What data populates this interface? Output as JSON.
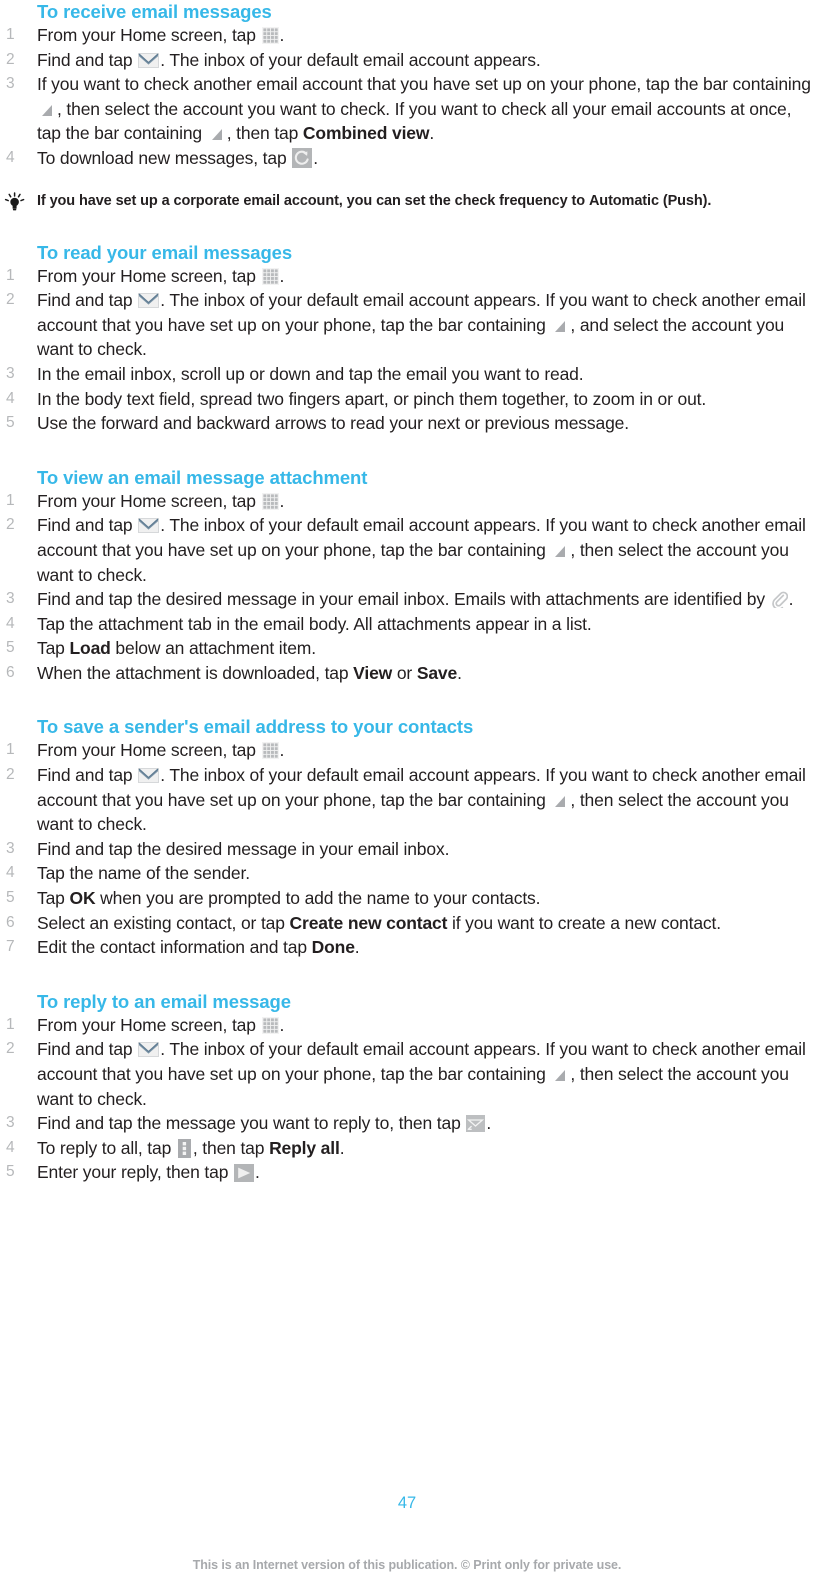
{
  "document": {
    "page_number": "47",
    "footer_note": "This is an Internet version of this publication. © Print only for private use.",
    "heading_color": "#37b8e8",
    "body_color": "#231f20",
    "number_color": "#b6b8ba",
    "footer_color": "#a7a9ac"
  },
  "sections": [
    {
      "title": "To receive email messages",
      "steps": [
        {
          "num": "1",
          "parts": [
            {
              "t": "text",
              "v": "From your Home screen, tap "
            },
            {
              "t": "icon",
              "v": "app-grid-icon"
            },
            {
              "t": "text",
              "v": "."
            }
          ]
        },
        {
          "num": "2",
          "parts": [
            {
              "t": "text",
              "v": "Find and tap "
            },
            {
              "t": "icon",
              "v": "envelope-icon"
            },
            {
              "t": "text",
              "v": ". The inbox of your default email account appears."
            }
          ]
        },
        {
          "num": "3",
          "parts": [
            {
              "t": "text",
              "v": "If you want to check another email account that you have set up on your phone, tap the bar containing "
            },
            {
              "t": "icon",
              "v": "triangle-icon"
            },
            {
              "t": "text",
              "v": ", then select the account you want to check. If you want to check all your email accounts at once, tap the bar containing "
            },
            {
              "t": "icon",
              "v": "triangle-icon"
            },
            {
              "t": "text",
              "v": ", then tap "
            },
            {
              "t": "bold",
              "v": "Combined view"
            },
            {
              "t": "text",
              "v": "."
            }
          ]
        },
        {
          "num": "4",
          "parts": [
            {
              "t": "text",
              "v": "To download new messages, tap "
            },
            {
              "t": "icon",
              "v": "refresh-icon"
            },
            {
              "t": "text",
              "v": "."
            }
          ]
        }
      ]
    },
    {
      "title": "To read your email messages",
      "steps": [
        {
          "num": "1",
          "parts": [
            {
              "t": "text",
              "v": "From your Home screen, tap "
            },
            {
              "t": "icon",
              "v": "app-grid-icon"
            },
            {
              "t": "text",
              "v": "."
            }
          ]
        },
        {
          "num": "2",
          "parts": [
            {
              "t": "text",
              "v": "Find and tap "
            },
            {
              "t": "icon",
              "v": "envelope-icon"
            },
            {
              "t": "text",
              "v": ". The inbox of your default email account appears. If you want to check another email account that you have set up on your phone, tap the bar containing "
            },
            {
              "t": "icon",
              "v": "triangle-icon"
            },
            {
              "t": "text",
              "v": ", and select the account you want to check."
            }
          ]
        },
        {
          "num": "3",
          "parts": [
            {
              "t": "text",
              "v": "In the email inbox, scroll up or down and tap the email you want to read."
            }
          ]
        },
        {
          "num": "4",
          "parts": [
            {
              "t": "text",
              "v": "In the body text field, spread two fingers apart, or pinch them together, to zoom in or out."
            }
          ]
        },
        {
          "num": "5",
          "parts": [
            {
              "t": "text",
              "v": "Use the forward and backward arrows to read your next or previous message."
            }
          ]
        }
      ]
    },
    {
      "title": "To view an email message attachment",
      "steps": [
        {
          "num": "1",
          "parts": [
            {
              "t": "text",
              "v": "From your Home screen, tap "
            },
            {
              "t": "icon",
              "v": "app-grid-icon"
            },
            {
              "t": "text",
              "v": "."
            }
          ]
        },
        {
          "num": "2",
          "parts": [
            {
              "t": "text",
              "v": "Find and tap "
            },
            {
              "t": "icon",
              "v": "envelope-icon"
            },
            {
              "t": "text",
              "v": ". The inbox of your default email account appears. If you want to check another email account that you have set up on your phone, tap the bar containing "
            },
            {
              "t": "icon",
              "v": "triangle-icon"
            },
            {
              "t": "text",
              "v": ", then select the account you want to check."
            }
          ]
        },
        {
          "num": "3",
          "parts": [
            {
              "t": "text",
              "v": "Find and tap the desired message in your email inbox. Emails with attachments are identified by "
            },
            {
              "t": "icon",
              "v": "paperclip-icon"
            },
            {
              "t": "text",
              "v": "."
            }
          ]
        },
        {
          "num": "4",
          "parts": [
            {
              "t": "text",
              "v": "Tap the attachment tab in the email body. All attachments appear in a list."
            }
          ]
        },
        {
          "num": "5",
          "parts": [
            {
              "t": "text",
              "v": "Tap "
            },
            {
              "t": "bold",
              "v": "Load"
            },
            {
              "t": "text",
              "v": " below an attachment item."
            }
          ]
        },
        {
          "num": "6",
          "parts": [
            {
              "t": "text",
              "v": "When the attachment is downloaded, tap "
            },
            {
              "t": "bold",
              "v": "View"
            },
            {
              "t": "text",
              "v": " or "
            },
            {
              "t": "bold",
              "v": "Save"
            },
            {
              "t": "text",
              "v": "."
            }
          ]
        }
      ]
    },
    {
      "title": "To save a sender's email address to your contacts",
      "steps": [
        {
          "num": "1",
          "parts": [
            {
              "t": "text",
              "v": "From your Home screen, tap "
            },
            {
              "t": "icon",
              "v": "app-grid-icon"
            },
            {
              "t": "text",
              "v": "."
            }
          ]
        },
        {
          "num": "2",
          "parts": [
            {
              "t": "text",
              "v": "Find and tap "
            },
            {
              "t": "icon",
              "v": "envelope-icon"
            },
            {
              "t": "text",
              "v": ". The inbox of your default email account appears. If you want to check another email account that you have set up on your phone, tap the bar containing "
            },
            {
              "t": "icon",
              "v": "triangle-icon"
            },
            {
              "t": "text",
              "v": ", then select the account you want to check."
            }
          ]
        },
        {
          "num": "3",
          "parts": [
            {
              "t": "text",
              "v": "Find and tap the desired message in your email inbox."
            }
          ]
        },
        {
          "num": "4",
          "parts": [
            {
              "t": "text",
              "v": "Tap the name of the sender."
            }
          ]
        },
        {
          "num": "5",
          "parts": [
            {
              "t": "text",
              "v": "Tap "
            },
            {
              "t": "bold",
              "v": "OK"
            },
            {
              "t": "text",
              "v": " when you are prompted to add the name to your contacts."
            }
          ]
        },
        {
          "num": "6",
          "parts": [
            {
              "t": "text",
              "v": "Select an existing contact, or tap "
            },
            {
              "t": "bold",
              "v": "Create new contact"
            },
            {
              "t": "text",
              "v": " if you want to create a new contact."
            }
          ]
        },
        {
          "num": "7",
          "parts": [
            {
              "t": "text",
              "v": "Edit the contact information and tap "
            },
            {
              "t": "bold",
              "v": "Done"
            },
            {
              "t": "text",
              "v": "."
            }
          ]
        }
      ]
    },
    {
      "title": "To reply to an email message",
      "steps": [
        {
          "num": "1",
          "parts": [
            {
              "t": "text",
              "v": "From your Home screen, tap "
            },
            {
              "t": "icon",
              "v": "app-grid-icon"
            },
            {
              "t": "text",
              "v": "."
            }
          ]
        },
        {
          "num": "2",
          "parts": [
            {
              "t": "text",
              "v": "Find and tap "
            },
            {
              "t": "icon",
              "v": "envelope-icon"
            },
            {
              "t": "text",
              "v": ". The inbox of your default email account appears. If you want to check another email account that you have set up on your phone, tap the bar containing "
            },
            {
              "t": "icon",
              "v": "triangle-icon"
            },
            {
              "t": "text",
              "v": ", then select the account you want to check."
            }
          ]
        },
        {
          "num": "3",
          "parts": [
            {
              "t": "text",
              "v": "Find and tap the message you want to reply to, then tap "
            },
            {
              "t": "icon",
              "v": "reply-icon"
            },
            {
              "t": "text",
              "v": "."
            }
          ]
        },
        {
          "num": "4",
          "parts": [
            {
              "t": "text",
              "v": "To reply to all, tap "
            },
            {
              "t": "icon",
              "v": "more-options-icon"
            },
            {
              "t": "text",
              "v": ", then tap "
            },
            {
              "t": "bold",
              "v": "Reply all"
            },
            {
              "t": "text",
              "v": "."
            }
          ]
        },
        {
          "num": "5",
          "parts": [
            {
              "t": "text",
              "v": "Enter your reply, then tap "
            },
            {
              "t": "icon",
              "v": "send-icon"
            },
            {
              "t": "text",
              "v": "."
            }
          ]
        }
      ]
    }
  ],
  "tip": {
    "icon": "lightbulb-icon",
    "parts": [
      {
        "t": "text",
        "v": "If you have set up a corporate email account, you can set the check frequency to "
      },
      {
        "t": "bold",
        "v": "Automatic (Push)"
      },
      {
        "t": "text",
        "v": "."
      }
    ]
  }
}
